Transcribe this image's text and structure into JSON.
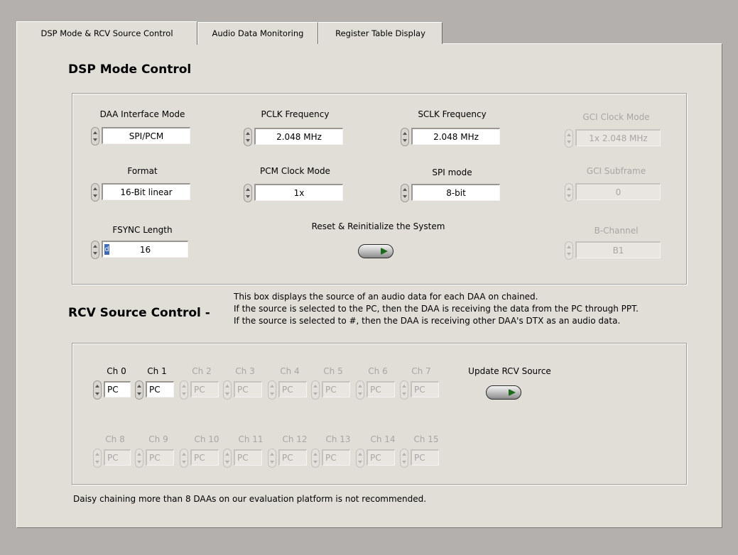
{
  "tabs": [
    {
      "label": "DSP Mode  & RCV Source Control",
      "active": true
    },
    {
      "label": "Audio Data Monitoring",
      "active": false
    },
    {
      "label": "Register Table Display",
      "active": false
    }
  ],
  "dsp": {
    "title": "DSP Mode Control",
    "daa_interface_mode": {
      "label": "DAA Interface Mode",
      "value": "SPI/PCM"
    },
    "pclk_frequency": {
      "label": "PCLK Frequency",
      "value": "2.048 MHz"
    },
    "sclk_frequency": {
      "label": "SCLK Frequency",
      "value": "2.048 MHz"
    },
    "gci_clock_mode": {
      "label": "GCI Clock Mode",
      "value": "1x 2.048 MHz"
    },
    "format": {
      "label": "Format",
      "value": "16-Bit linear"
    },
    "pcm_clock_mode": {
      "label": "PCM Clock Mode",
      "value": "1x"
    },
    "spi_mode": {
      "label": "SPI mode",
      "value": "8-bit"
    },
    "gci_subframe": {
      "label": "GCI Subframe",
      "value": "0"
    },
    "fsync_length": {
      "label": "FSYNC Length",
      "value": "16",
      "radix": "d"
    },
    "reset_label": "Reset & Reinitialize the System",
    "b_channel": {
      "label": "B-Channel",
      "value": "B1"
    }
  },
  "rcv": {
    "title": "RCV Source Control -",
    "description": [
      "This box displays the source of an audio data for each DAA on chained.",
      "If the source is selected to the PC, then the DAA is receiving the data from the PC through PPT.",
      "If the source is selected to #, then the DAA is receiving other DAA's DTX as an audio data."
    ],
    "channels": [
      {
        "label": "Ch 0",
        "value": "PC"
      },
      {
        "label": "Ch 1",
        "value": "PC"
      },
      {
        "label": "Ch 2",
        "value": "PC"
      },
      {
        "label": "Ch 3",
        "value": "PC"
      },
      {
        "label": "Ch 4",
        "value": "PC"
      },
      {
        "label": "Ch 5",
        "value": "PC"
      },
      {
        "label": "Ch 6",
        "value": "PC"
      },
      {
        "label": "Ch 7",
        "value": "PC"
      },
      {
        "label": "Ch 8",
        "value": "PC"
      },
      {
        "label": "Ch 9",
        "value": "PC"
      },
      {
        "label": "Ch 10",
        "value": "PC"
      },
      {
        "label": "Ch 11",
        "value": "PC"
      },
      {
        "label": "Ch 12",
        "value": "PC"
      },
      {
        "label": "Ch 13",
        "value": "PC"
      },
      {
        "label": "Ch 14",
        "value": "PC"
      },
      {
        "label": "Ch 15",
        "value": "PC"
      }
    ],
    "update_label": "Update RCV Source",
    "footer_note": "Daisy chaining more than 8 DAAs on our evaluation platform is not recommended."
  }
}
